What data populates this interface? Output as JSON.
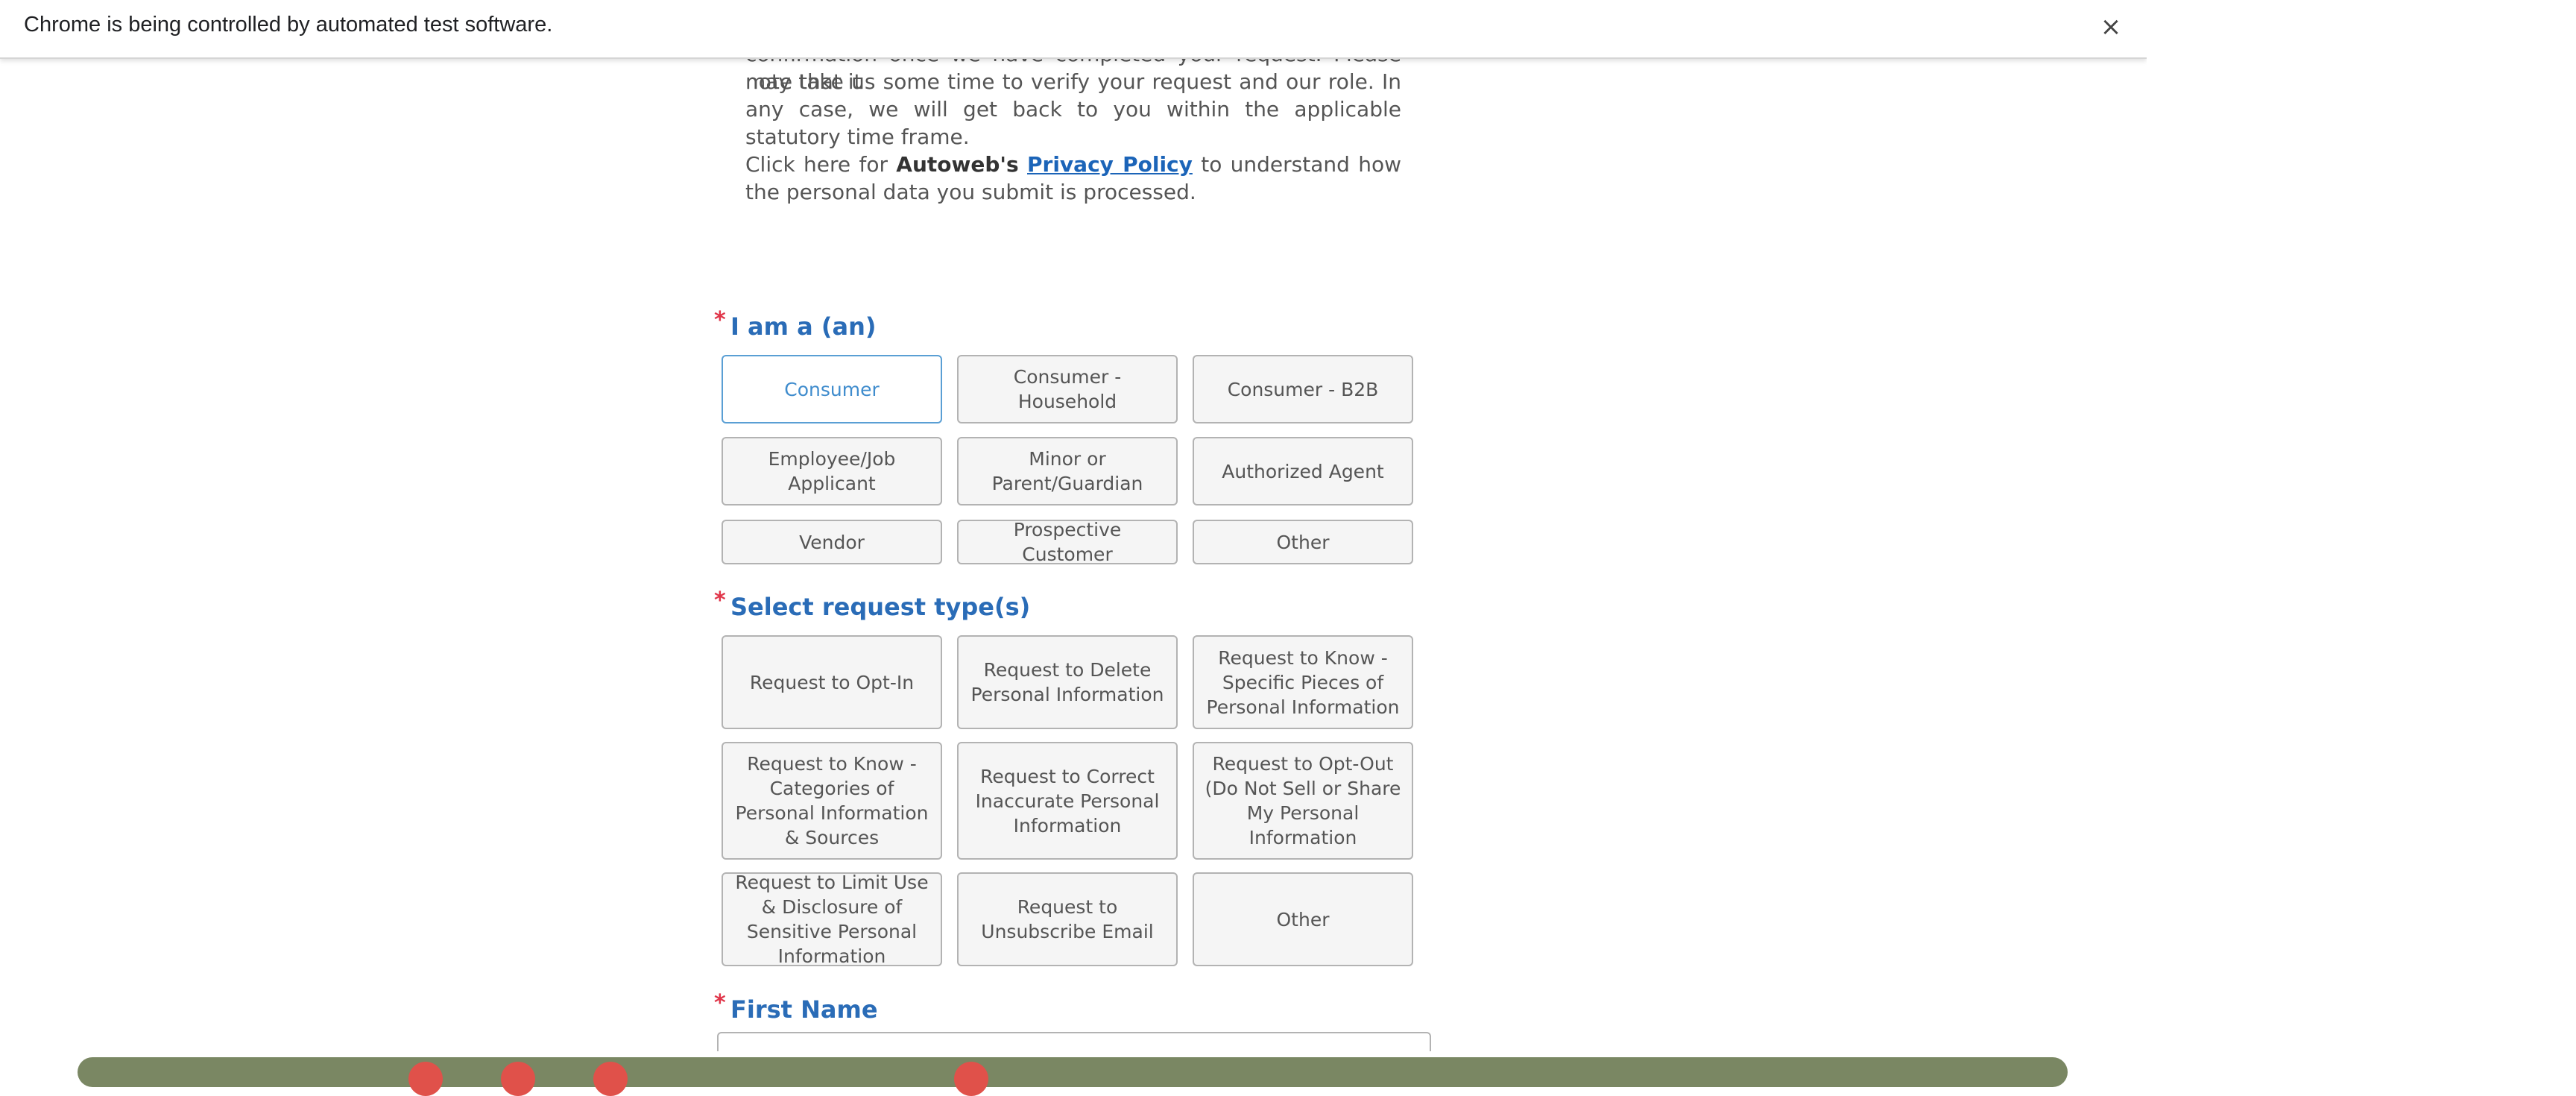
{
  "infobar": {
    "message": "Chrome is being controlled by automated test software.",
    "close_glyph": "×"
  },
  "intro": {
    "partial_line": "confirmation once we have completed your request. Please note that it",
    "verify_text": "may take us some time to verify your request and our role. In any case, we will get back to you within the applicable statutory time frame.",
    "privacy_prefix": "Click here for",
    "company": "Autoweb's",
    "privacy_link": "Privacy Policy",
    "privacy_suffix": "to understand how the personal data you submit is processed."
  },
  "role_section": {
    "required_mark": "*",
    "label": "I am a (an)",
    "options": [
      {
        "label": "Consumer",
        "selected": true
      },
      {
        "label": "Consumer - Household",
        "selected": false
      },
      {
        "label": "Consumer - B2B",
        "selected": false
      },
      {
        "label": "Employee/Job Applicant",
        "selected": false
      },
      {
        "label": "Minor or Parent/Guardian",
        "selected": false
      },
      {
        "label": "Authorized Agent",
        "selected": false
      },
      {
        "label": "Vendor",
        "selected": false
      },
      {
        "label": "Prospective Customer",
        "selected": false
      },
      {
        "label": "Other",
        "selected": false
      }
    ]
  },
  "request_section": {
    "required_mark": "*",
    "label": "Select request type(s)",
    "options": [
      {
        "label": "Request to Opt-In"
      },
      {
        "label": "Request to Delete Personal Information"
      },
      {
        "label": "Request to Know - Specific Pieces of Personal Information"
      },
      {
        "label": "Request to Know - Categories of Personal Information & Sources"
      },
      {
        "label": "Request to Correct Inaccurate Personal Information"
      },
      {
        "label": "Request to Opt-Out (Do Not Sell or Share My Personal Information"
      },
      {
        "label": "Request to Limit Use & Disclosure of Sensitive Personal Information"
      },
      {
        "label": "Request to Unsubscribe Email"
      },
      {
        "label": "Other"
      }
    ]
  },
  "first_name": {
    "required_mark": "*",
    "label": "First Name",
    "value": ""
  },
  "colors": {
    "accent": "#2a6cb7",
    "link": "#1b64b8",
    "required": "#e0364a",
    "selected_border": "#5a9fd4"
  }
}
